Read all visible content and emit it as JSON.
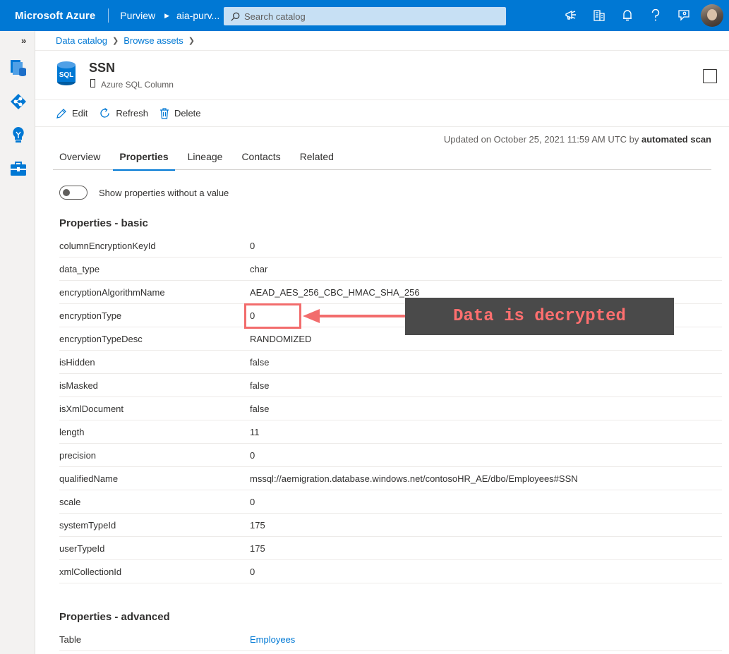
{
  "topbar": {
    "brand": "Microsoft Azure",
    "service": "Purview",
    "resource": "aia-purv...",
    "search_placeholder": "Search catalog",
    "icons": [
      "feedback-icon",
      "directory-icon",
      "notifications-icon",
      "help-icon",
      "people-feedback-icon",
      "avatar"
    ]
  },
  "rail": {
    "expand_label": "»",
    "items": [
      "data-catalog-icon",
      "data-map-icon",
      "insights-icon",
      "management-icon"
    ]
  },
  "breadcrumb": [
    "Data catalog",
    "Browse assets"
  ],
  "asset": {
    "icon_label": "SQL",
    "title": "SSN",
    "type": "Azure SQL Column"
  },
  "commands": {
    "edit": "Edit",
    "refresh": "Refresh",
    "delete": "Delete"
  },
  "updated": {
    "prefix": "Updated on October 25, 2021 11:59 AM UTC by",
    "by": "automated scan"
  },
  "tabs": [
    "Overview",
    "Properties",
    "Lineage",
    "Contacts",
    "Related"
  ],
  "active_tab": "Properties",
  "toggle_label": "Show properties without a value",
  "basic": {
    "title": "Properties - basic",
    "rows": [
      {
        "key": "columnEncryptionKeyId",
        "value": "0"
      },
      {
        "key": "data_type",
        "value": "char"
      },
      {
        "key": "encryptionAlgorithmName",
        "value": "AEAD_AES_256_CBC_HMAC_SHA_256"
      },
      {
        "key": "encryptionType",
        "value": "0"
      },
      {
        "key": "encryptionTypeDesc",
        "value": "RANDOMIZED"
      },
      {
        "key": "isHidden",
        "value": "false"
      },
      {
        "key": "isMasked",
        "value": "false"
      },
      {
        "key": "isXmlDocument",
        "value": "false"
      },
      {
        "key": "length",
        "value": "11"
      },
      {
        "key": "precision",
        "value": "0"
      },
      {
        "key": "qualifiedName",
        "value": "mssql://aemigration.database.windows.net/contosoHR_AE/dbo/Employees#SSN"
      },
      {
        "key": "scale",
        "value": "0"
      },
      {
        "key": "systemTypeId",
        "value": "175"
      },
      {
        "key": "userTypeId",
        "value": "175"
      },
      {
        "key": "xmlCollectionId",
        "value": "0"
      }
    ]
  },
  "advanced": {
    "title": "Properties - advanced",
    "rows": [
      {
        "key": "Table",
        "value": "Employees"
      }
    ]
  },
  "annotation": {
    "text": "Data is decrypted",
    "color": "#ff6f6f"
  }
}
